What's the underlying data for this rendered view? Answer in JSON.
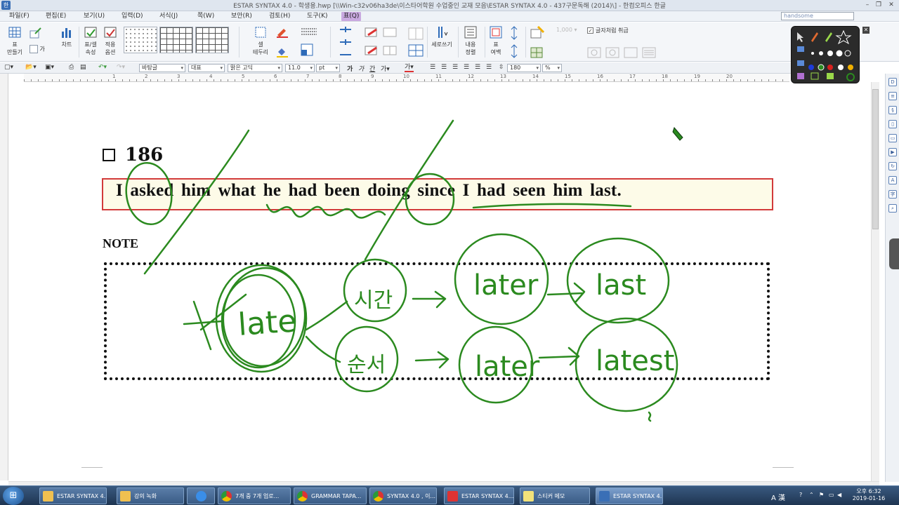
{
  "window": {
    "title": "ESTAR SYNTAX 4.0 - 학생용.hwp [\\\\Win-c32v06ha3de\\이스타어학원 수업중인 교재 모음\\ESTAR SYNTAX 4.0 - 437구문독해 (2014)\\] - 한컴오피스 한글",
    "icon": "hwp-app-icon"
  },
  "menu": {
    "items": [
      "파일(F)",
      "편집(E)",
      "보기(U)",
      "입력(D)",
      "서식(J)",
      "쪽(W)",
      "보안(R)",
      "검토(H)",
      "도구(K)",
      "표(Q)"
    ],
    "active": "표(Q)",
    "font_search": "handsome"
  },
  "ribbon": {
    "make_table": "표\n만들기",
    "cell_label": "가",
    "chart": "차트",
    "table_props": "표/셀\n속성",
    "apply_option": "적용\n옵션",
    "cell_border": "셀\n테두리",
    "vertical_write": "세로쓰기",
    "content_align": "내용\n정렬",
    "table_margin": "표\n여백",
    "treat_as_char": "글자처럼 취급",
    "treat_as_char_checked": true
  },
  "format": {
    "style": "바탕글",
    "lang": "대표",
    "font": "맑은 고딕",
    "size": "11.0",
    "unit": "pt",
    "zoom": "180",
    "zoom_unit": "%"
  },
  "ruler": {
    "marks": [
      "1",
      "2",
      "3",
      "4",
      "5",
      "6",
      "7",
      "8",
      "9",
      "10",
      "11",
      "12",
      "13",
      "14",
      "15",
      "16",
      "17",
      "18",
      "19",
      "20"
    ]
  },
  "document": {
    "question_number": "186",
    "sentence": "I asked him what he had been doing since I had seen him last.",
    "note_label": "NOTE",
    "ink_words": [
      "late",
      "시간",
      "later",
      "last",
      "순서",
      "later",
      "latest"
    ]
  },
  "taskbar": {
    "tasks": [
      "ESTAR SYNTAX 4...",
      "강의 녹화",
      "7개 중 7개 업로...",
      "GRAMMAR TAPA...",
      "SYNTAX 4.0 , 이...",
      "ESTAR SYNTAX 4...",
      "스티커 메모",
      "ESTAR SYNTAX 4..."
    ],
    "tray_label": "A 漢",
    "time": "오후 6:32",
    "date": "2019-01-16"
  },
  "colors": {
    "ink": "#2b8a1f",
    "sentence_border": "#d23a3a",
    "sentence_bg": "#fdfbe8",
    "menu_active": "#c9a9e0"
  }
}
